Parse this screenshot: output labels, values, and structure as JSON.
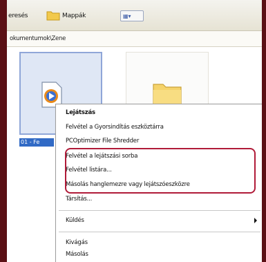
{
  "toolbar": {
    "search_label": "eresés",
    "folders_label": "Mappák",
    "views_label": "▦▾"
  },
  "address": {
    "path": "okumentumok\\Zene"
  },
  "files": {
    "selected_label": "01 - Fe"
  },
  "context_menu": {
    "items": [
      {
        "label": "Lejátszás",
        "bold": true
      },
      {
        "label": "Felvétel a Gyorsindítás eszköztárra"
      },
      {
        "label": "PCOptimizer File Shredder"
      },
      {
        "label": "Felvétel a lejátszási sorba"
      },
      {
        "label": "Felvétel listára..."
      },
      {
        "label": "Másolás hanglemezre vagy lejátszóeszközre"
      },
      {
        "label": "Társítás..."
      },
      {
        "label": "Küldés"
      },
      {
        "label": "Kivágás"
      },
      {
        "label": "Másolás"
      }
    ]
  },
  "colors": {
    "background": "#5a1015",
    "highlight": "#b01a38",
    "selection": "#316ac5"
  }
}
